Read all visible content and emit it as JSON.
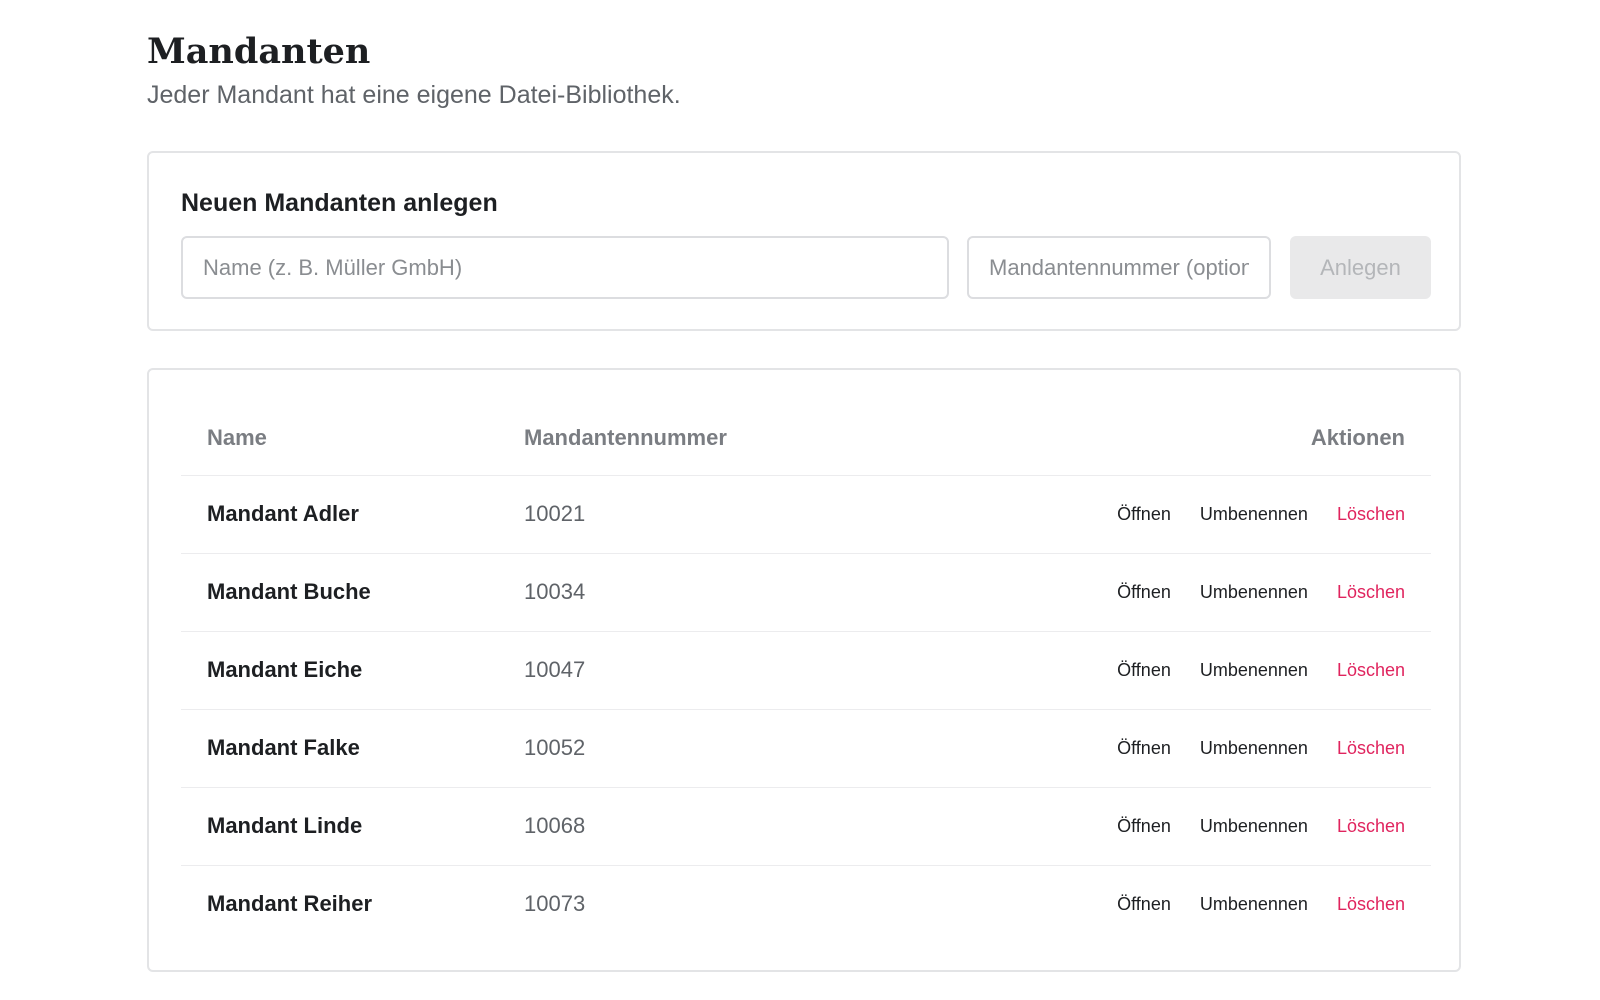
{
  "header": {
    "title": "Mandanten",
    "subtitle": "Jeder Mandant hat eine eigene Datei-Bibliothek."
  },
  "create_form": {
    "title": "Neuen Mandanten anlegen",
    "name_placeholder": "Name (z. B. Müller GmbH)",
    "name_value": "",
    "number_placeholder": "Mandantennummer (optional)",
    "number_value": "",
    "submit_label": "Anlegen",
    "submit_enabled": false
  },
  "table": {
    "columns": [
      "Name",
      "Mandantennummer",
      "Aktionen"
    ],
    "action_labels": {
      "open": "Öffnen",
      "rename": "Umbenennen",
      "delete": "Löschen"
    },
    "rows": [
      {
        "name": "Mandant Adler",
        "number": "10021"
      },
      {
        "name": "Mandant Buche",
        "number": "10034"
      },
      {
        "name": "Mandant Eiche",
        "number": "10047"
      },
      {
        "name": "Mandant Falke",
        "number": "10052"
      },
      {
        "name": "Mandant Linde",
        "number": "10068"
      },
      {
        "name": "Mandant Reiher",
        "number": "10073"
      }
    ]
  },
  "colors": {
    "delete_action": "#e0245e",
    "muted_text": "#5f6368",
    "border": "#e3e4e6"
  }
}
